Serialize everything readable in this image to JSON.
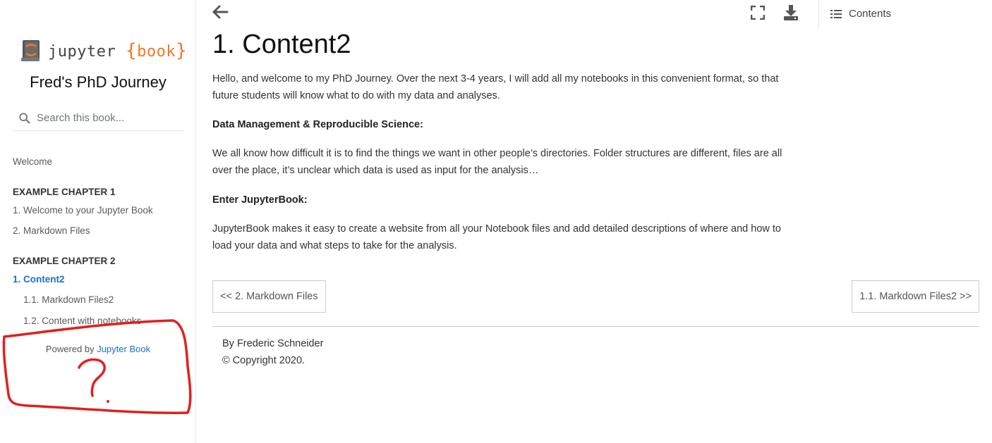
{
  "sidebar": {
    "logo_word": "jupyter",
    "logo_open_brace": "{",
    "logo_book": "book",
    "logo_close_brace": "}",
    "site_title": "Fred's PhD Journey",
    "search_placeholder": "Search this book...",
    "welcome": "Welcome",
    "chapter1_caption": "EXAMPLE CHAPTER 1",
    "chapter1_items": [
      "1. Welcome to your Jupyter Book",
      "2. Markdown Files"
    ],
    "chapter2_caption": "EXAMPLE CHAPTER 2",
    "chapter2_active": "1. Content2",
    "chapter2_sub_items": [
      "1.1. Markdown Files2",
      "1.2. Content with notebooks"
    ],
    "powered_by": "Powered by",
    "powered_link": "Jupyter Book"
  },
  "topbar": {
    "toc_label": "Contents"
  },
  "main": {
    "title": "1. Content2",
    "intro": "Hello, and welcome to my PhD Journey. Over the next 3-4 years, I will add all my notebooks in this convenient format, so that future students will know what to do with my data and analyses.",
    "heading1": "Data Management & Reproducible Science:",
    "para1": "We all know how difficult it is to find the things we want in other people’s directories. Folder structures are different, files are all over the place, it’s unclear which data is used as input for the analysis…",
    "heading2": "Enter JupyterBook:",
    "para2": "JupyterBook makes it easy to create a website from all your Notebook files and add detailed descriptions of where and how to load your data and what steps to take for the analysis.",
    "prev_label": "<< 2. Markdown Files",
    "next_label": "1.1. Markdown Files2 >>",
    "footer_author": "By Frederic Schneider",
    "footer_copyright": "© Copyright 2020."
  },
  "colors": {
    "accent": "#1f6fc5",
    "brand_orange": "#f37726",
    "annotation_red": "#e02020"
  },
  "icons": {
    "back": "arrow-left-icon",
    "fullscreen": "fullscreen-icon",
    "download": "download-icon",
    "toc": "list-icon",
    "search": "search-icon",
    "logo": "jupyter-book-logo-icon"
  }
}
